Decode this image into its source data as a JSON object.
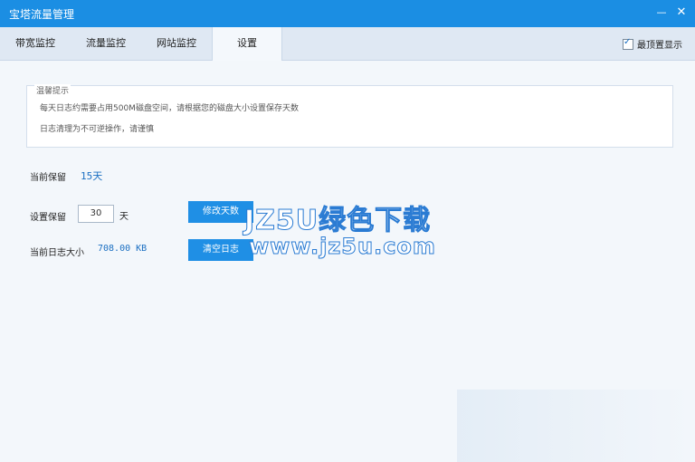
{
  "window": {
    "title": "宝塔流量管理"
  },
  "tabs": [
    {
      "label": "带宽监控"
    },
    {
      "label": "流量监控"
    },
    {
      "label": "网站监控"
    },
    {
      "label": "设置"
    }
  ],
  "topmost": {
    "label": "最顶置显示"
  },
  "tips": {
    "title": "温馨提示",
    "line1": "每天日志约需要占用500M磁盘空间，请根据您的磁盘大小设置保存天数",
    "line2": "日志清理为不可逆操作，请谨慎"
  },
  "retention": {
    "label": "当前保留",
    "value": "15天"
  },
  "setting": {
    "label": "设置保留",
    "input_value": "30",
    "unit": "天",
    "button": "修改天数"
  },
  "logsize": {
    "label": "当前日志大小",
    "value": "708.00 KB",
    "button": "清空日志"
  },
  "watermark": {
    "line1": "JZ5U绿色下载",
    "line2": "www.jz5u.com"
  }
}
